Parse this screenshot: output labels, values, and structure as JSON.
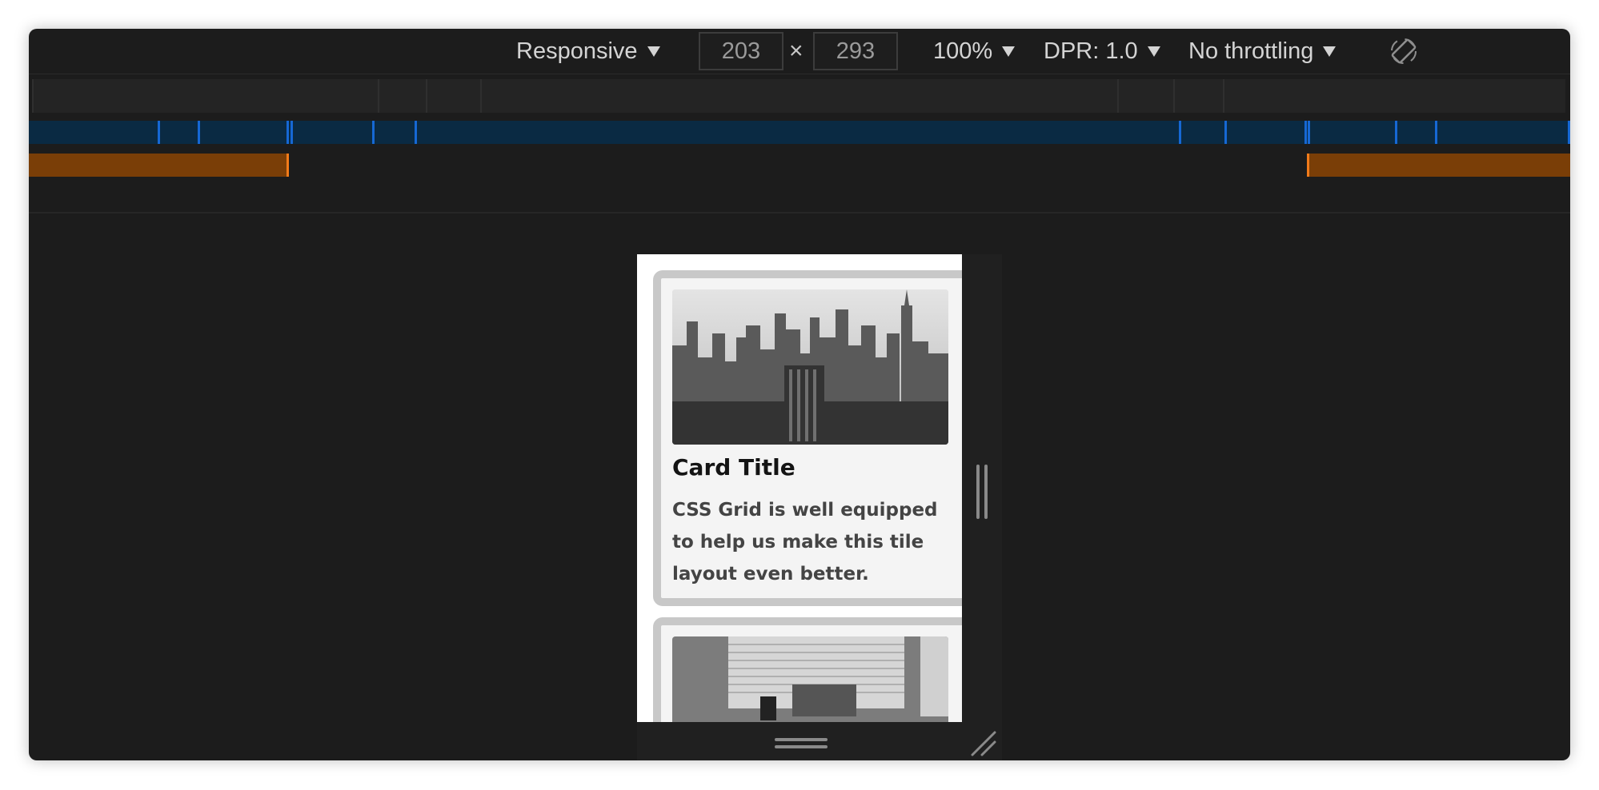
{
  "toolbar": {
    "device": "Responsive",
    "width": "203",
    "times": "×",
    "height": "293",
    "zoom": "100%",
    "dpr": "DPR: 1.0",
    "throttling": "No throttling"
  },
  "cards": [
    {
      "title": "Card Title",
      "text": "CSS Grid is well equipped to help us make this tile layout even better."
    }
  ],
  "colors": {
    "window_bg": "#1c1c1c",
    "blue_band": "#0a2a43",
    "blue_tick": "#1668d4",
    "orange_band": "#7a3e07",
    "orange_tick": "#f27b1a",
    "card_border": "#c8c8c8"
  },
  "icons": [
    "dropdown-triangle-icon",
    "rotate-device-icon",
    "resize-handle-icon"
  ]
}
